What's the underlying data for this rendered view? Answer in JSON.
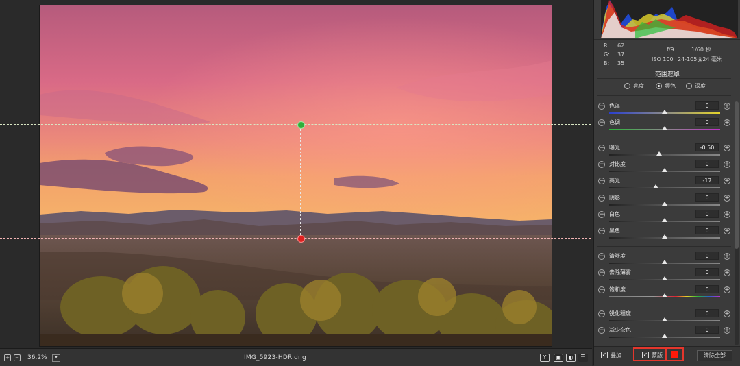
{
  "status_bar": {
    "zoom": "36.2%",
    "filename": "IMG_5923-HDR.dng"
  },
  "info": {
    "rgb": [
      {
        "key": "R:",
        "value": "62"
      },
      {
        "key": "G:",
        "value": "37"
      },
      {
        "key": "B:",
        "value": "35"
      }
    ],
    "aperture": "f/9",
    "shutter": "1/60 秒",
    "iso": "ISO 100",
    "lens": "24-105@24 毫米"
  },
  "panel": {
    "title": "范围遮罩",
    "modes": [
      {
        "label": "亮度",
        "selected": false
      },
      {
        "label": "颜色",
        "selected": true
      },
      {
        "label": "深度",
        "selected": false
      }
    ],
    "sliders": [
      {
        "label": "色温",
        "value": "0",
        "level": 0.5,
        "track": "temp"
      },
      {
        "label": "色调",
        "value": "0",
        "level": 0.5,
        "track": "tint"
      },
      {
        "label": "曝光",
        "value": "-0.50",
        "level": 0.45,
        "track": "gray"
      },
      {
        "label": "对比度",
        "value": "0",
        "level": 0.5,
        "track": "gray"
      },
      {
        "label": "高光",
        "value": "-17",
        "level": 0.42,
        "track": "gray"
      },
      {
        "label": "阴影",
        "value": "0",
        "level": 0.5,
        "track": "gray"
      },
      {
        "label": "白色",
        "value": "0",
        "level": 0.5,
        "track": "gray"
      },
      {
        "label": "黑色",
        "value": "0",
        "level": 0.5,
        "track": "gray"
      },
      {
        "label": "清晰度",
        "value": "0",
        "level": 0.5,
        "track": "gray"
      },
      {
        "label": "去除薄雾",
        "value": "0",
        "level": 0.5,
        "track": "gray"
      },
      {
        "label": "饱和度",
        "value": "0",
        "level": 0.5,
        "track": "sat"
      },
      {
        "label": "锐化程度",
        "value": "0",
        "level": 0.5,
        "track": "gray"
      },
      {
        "label": "减少杂色",
        "value": "0",
        "level": 0.5,
        "track": "gray"
      }
    ]
  },
  "bottom": {
    "overlay_label": "叠加",
    "mask_label": "蒙版",
    "clear_all": "清除全部"
  },
  "colors": {
    "mask_highlight": "#e4362c",
    "mask_color_swatch": "#ff1a0a",
    "guide_green": "#2fae3a",
    "guide_red": "#e0201f"
  }
}
